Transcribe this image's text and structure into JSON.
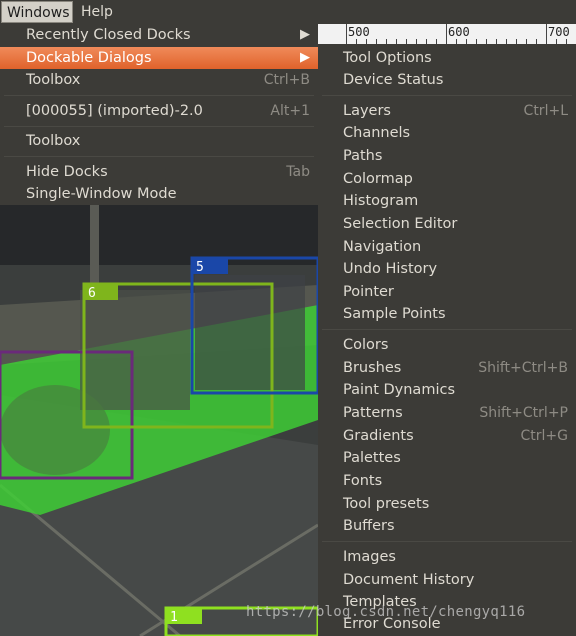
{
  "menubar": {
    "items": [
      {
        "label": "Windows"
      },
      {
        "label": "Help"
      }
    ]
  },
  "ruler": {
    "labels": [
      "500",
      "600",
      "700"
    ]
  },
  "windows_menu": {
    "items": [
      {
        "label": "Recently Closed Docks",
        "submenu": true
      },
      {
        "label": "Dockable Dialogs",
        "submenu": true,
        "highlighted": true
      },
      {
        "label": "Toolbox",
        "shortcut": "Ctrl+B"
      },
      {
        "label": "[000055] (imported)-2.0",
        "shortcut": "Alt+1"
      },
      {
        "label": "Toolbox"
      },
      {
        "label": "Hide Docks",
        "shortcut": "Tab"
      },
      {
        "label": "Single-Window Mode"
      }
    ]
  },
  "dockable_dialogs_menu": {
    "items": [
      {
        "label": "Tool Options"
      },
      {
        "label": "Device Status"
      },
      {
        "label": "Layers",
        "shortcut": "Ctrl+L"
      },
      {
        "label": "Channels"
      },
      {
        "label": "Paths"
      },
      {
        "label": "Colormap"
      },
      {
        "label": "Histogram"
      },
      {
        "label": "Selection Editor"
      },
      {
        "label": "Navigation"
      },
      {
        "label": "Undo History"
      },
      {
        "label": "Pointer"
      },
      {
        "label": "Sample Points"
      },
      {
        "label": "Colors"
      },
      {
        "label": "Brushes",
        "shortcut": "Shift+Ctrl+B"
      },
      {
        "label": "Paint Dynamics"
      },
      {
        "label": "Patterns",
        "shortcut": "Shift+Ctrl+P"
      },
      {
        "label": "Gradients",
        "shortcut": "Ctrl+G"
      },
      {
        "label": "Palettes"
      },
      {
        "label": "Fonts"
      },
      {
        "label": "Tool presets"
      },
      {
        "label": "Buffers"
      },
      {
        "label": "Images"
      },
      {
        "label": "Document History"
      },
      {
        "label": "Templates"
      },
      {
        "label": "Error Console"
      }
    ]
  },
  "canvas": {
    "boxes": [
      {
        "label": "6",
        "color": "#7fb51c"
      },
      {
        "label": "5",
        "color": "#1a47a8"
      },
      {
        "label": "1",
        "color": "#8fe020"
      }
    ],
    "highlight_color": "#3ed234"
  },
  "watermark": "https://blog.csdn.net/chengyq116"
}
